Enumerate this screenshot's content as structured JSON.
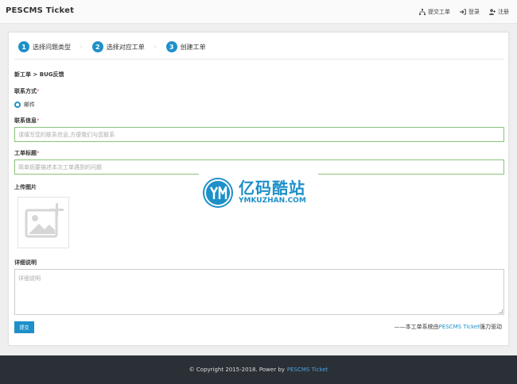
{
  "app": {
    "brand": "PESCMS Ticket"
  },
  "nav": {
    "submit_ticket": "提交工单",
    "login": "登录",
    "register": "注册"
  },
  "steps": [
    {
      "num": "1",
      "label": "选择问题类型"
    },
    {
      "num": "2",
      "label": "选择对应工单"
    },
    {
      "num": "3",
      "label": "创建工单"
    }
  ],
  "breadcrumb": "新工单 > BUG反馈",
  "form": {
    "contact_method_label": "联系方式",
    "contact_method_option": "邮件",
    "contact_info_label": "联系信息",
    "contact_info_placeholder": "请填写您的联系信息,方便我们与您联系",
    "title_label": "工单标题",
    "title_placeholder": "简单扼要描述本次工单遇到的问题",
    "upload_label": "上传图片",
    "detail_label": "详细说明",
    "detail_placeholder": "详细说明",
    "submit_label": "提交",
    "required_mark": "*"
  },
  "powered": {
    "prefix": "——本工单系统由",
    "link": "PESCMS Ticket",
    "suffix": "强力驱动"
  },
  "watermark": {
    "cn": "亿码酷站",
    "en": "YMKUZHAN.COM"
  },
  "footer": {
    "copyright": "© Copyright 2015-2018. Power by",
    "link": "PESCMS Ticket"
  },
  "colors": {
    "accent": "#1e90c9",
    "valid_border": "#8bc37a",
    "footer_bg": "#2b3036"
  }
}
